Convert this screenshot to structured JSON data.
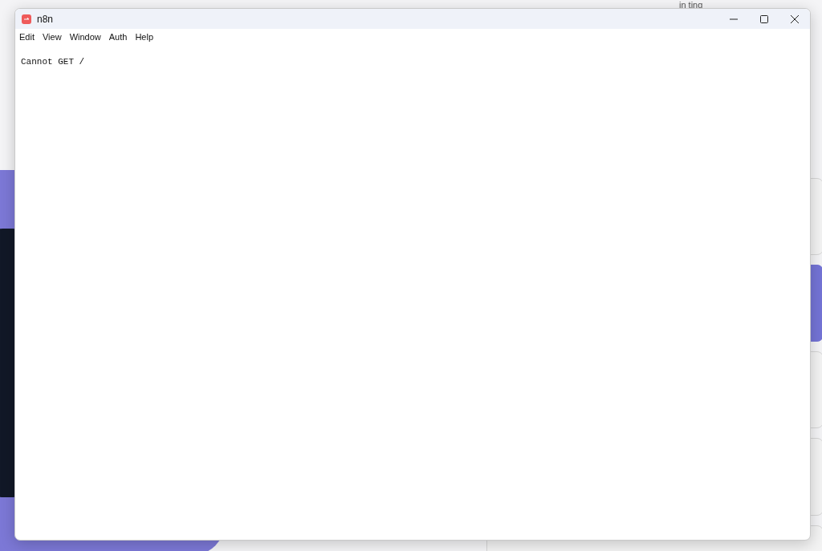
{
  "background": {
    "text_fragment": "in ting"
  },
  "window": {
    "title": "n8n"
  },
  "menu": [
    "Edit",
    "View",
    "Window",
    "Auth",
    "Help"
  ],
  "content": {
    "message": "Cannot GET /"
  }
}
